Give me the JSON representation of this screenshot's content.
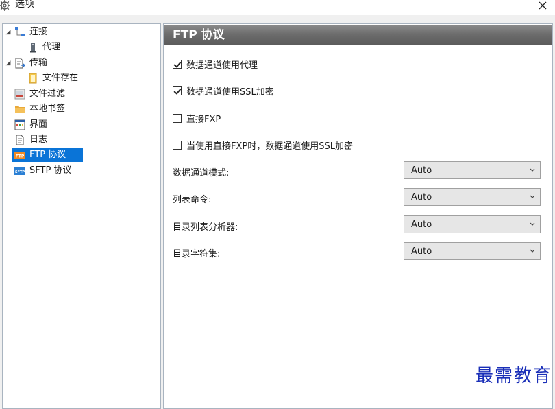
{
  "window": {
    "title": "选项",
    "close_icon": "×"
  },
  "tree": {
    "items": [
      {
        "label": "连接",
        "icon": "network-icon",
        "expanded": true,
        "level": 0
      },
      {
        "label": "代理",
        "icon": "proxy-server-icon",
        "level": 1
      },
      {
        "label": "传输",
        "icon": "transfer-document-icon",
        "expanded": true,
        "level": 0
      },
      {
        "label": "文件存在",
        "icon": "file-exists-icon",
        "level": 1
      },
      {
        "label": "文件过滤",
        "icon": "filter-icon",
        "level": 0
      },
      {
        "label": "本地书签",
        "icon": "folder-icon",
        "level": 0
      },
      {
        "label": "界面",
        "icon": "window-icon",
        "level": 0
      },
      {
        "label": "日志",
        "icon": "log-icon",
        "level": 0
      },
      {
        "label": "FTP 协议",
        "icon": "ftp-icon",
        "level": 0,
        "selected": true,
        "badge": "FTP"
      },
      {
        "label": "SFTP 协议",
        "icon": "sftp-icon",
        "level": 0,
        "badge": "SFTP"
      }
    ]
  },
  "panel": {
    "title": "FTP 协议",
    "options": [
      {
        "label": "数据通道使用代理",
        "checked": true
      },
      {
        "label": "数据通道使用SSL加密",
        "checked": true
      },
      {
        "label": "直接FXP",
        "checked": false
      },
      {
        "label": "当使用直接FXP时，数据通道使用SSL加密",
        "checked": false
      }
    ],
    "fields": [
      {
        "label": "数据通道模式:",
        "value": "Auto"
      },
      {
        "label": "列表命令:",
        "value": "Auto"
      },
      {
        "label": "目录列表分析器:",
        "value": "Auto"
      },
      {
        "label": "目录字符集:",
        "value": "Auto"
      }
    ]
  },
  "watermark": "最需教育",
  "colors": {
    "selection": "#0a74d7",
    "header_gradient_top": "#8c8c8c",
    "header_gradient_bottom": "#5a5a5a",
    "watermark": "#1a2fb8"
  }
}
